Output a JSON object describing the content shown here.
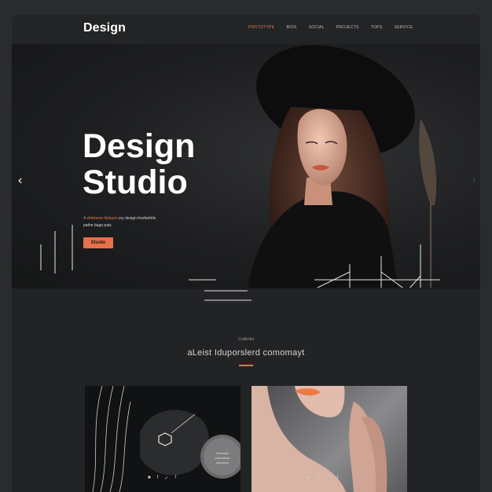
{
  "header": {
    "logo": "Design",
    "nav": [
      {
        "label": "PROTOTYPE",
        "active": true
      },
      {
        "label": "BIOS"
      },
      {
        "label": "SOCIAL"
      },
      {
        "label": "PROJECTS"
      },
      {
        "label": "TOPS"
      },
      {
        "label": "SERVICE"
      }
    ]
  },
  "hero": {
    "title_line1": "Design",
    "title_line2": "Studio",
    "text_accent": "A shdmene  litnkaon",
    "text_rest": " sry design hncfentrtis",
    "text_line2": "pathe bage pais",
    "cta_label": "Stuido",
    "prev_icon": "chevron-left-icon",
    "next_icon": "chevron-right-icon"
  },
  "section": {
    "eyebrow": "Craftcdm",
    "title": "aLeist Iduporslerd comomayt",
    "accent_color": "#e8704a"
  },
  "cards": [
    {
      "badge_line1": "Ecoasde",
      "badge_line2": "prtemacas",
      "badge_line3": "cosmesn",
      "icons": [
        "square-icon",
        "f-icon",
        "check-icon",
        "f-icon"
      ]
    },
    {
      "icons": [
        "f-icon",
        "twitter-icon",
        "b-icon",
        "instagram-icon",
        "f-icon"
      ]
    }
  ],
  "colors": {
    "accent": "#e8704a",
    "background": "#222325"
  }
}
